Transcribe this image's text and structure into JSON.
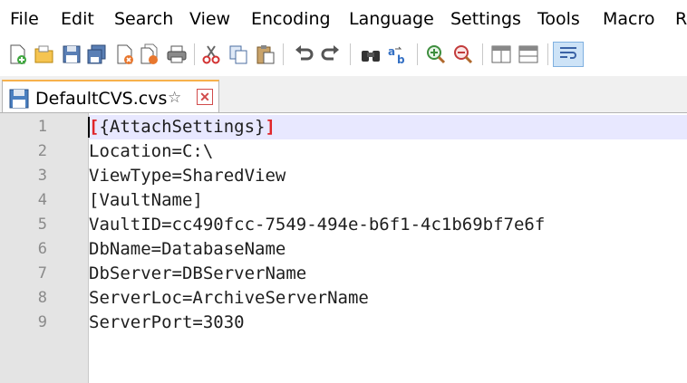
{
  "menu": [
    "File",
    "Edit",
    "Search",
    "View",
    "Encoding",
    "Language",
    "Settings",
    "Tools",
    "Macro",
    "R"
  ],
  "tab": {
    "filename": "DefaultCVS.cvs"
  },
  "editor": {
    "line_numbers": [
      "1",
      "2",
      "3",
      "4",
      "5",
      "6",
      "7",
      "8",
      "9"
    ],
    "lines": [
      {
        "open": "[",
        "text": "{AttachSettings}",
        "close": "]"
      },
      {
        "text": "Location=C:\\"
      },
      {
        "text": "ViewType=SharedView"
      },
      {
        "text": "[VaultName]"
      },
      {
        "text": "VaultID=cc490fcc-7549-494e-b6f1-4c1b69bf7e6f"
      },
      {
        "text": "DbName=DatabaseName"
      },
      {
        "text": "DbServer=DBServerName"
      },
      {
        "text": "ServerLoc=ArchiveServerName"
      },
      {
        "text": "ServerPort=3030"
      }
    ]
  },
  "colors": {
    "bracket_highlight": "#e0252a",
    "current_line": "#e8e8ff",
    "gutter": "#e4e4e4",
    "tab_accent": "#f7b14c"
  },
  "icons": [
    "new-file-icon",
    "open-file-icon",
    "save-icon",
    "save-all-icon",
    "close-icon",
    "close-all-icon",
    "print-icon",
    "cut-icon",
    "copy-icon",
    "paste-icon",
    "undo-icon",
    "redo-icon",
    "find-icon",
    "replace-icon",
    "zoom-in-icon",
    "zoom-out-icon",
    "sync-vertical-icon",
    "sync-horizontal-icon",
    "word-wrap-icon"
  ]
}
